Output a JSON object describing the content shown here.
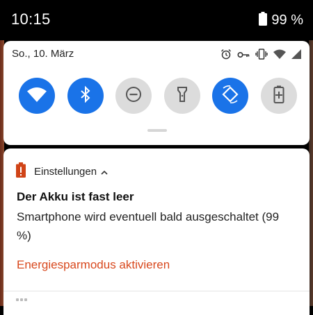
{
  "status_bar": {
    "time": "10:15",
    "battery_percent": "99 %"
  },
  "quick_settings": {
    "date": "So., 10. März",
    "status_icons": [
      "alarm-icon",
      "vpn-key-icon",
      "vibrate-icon",
      "wifi-signal-icon",
      "cell-signal-icon"
    ],
    "tiles": [
      {
        "name": "wifi",
        "icon": "wifi-icon",
        "state": "on"
      },
      {
        "name": "bluetooth",
        "icon": "bluetooth-icon",
        "state": "on"
      },
      {
        "name": "do-not-disturb",
        "icon": "do-not-disturb-icon",
        "state": "off"
      },
      {
        "name": "flashlight",
        "icon": "flashlight-icon",
        "state": "off"
      },
      {
        "name": "auto-rotate",
        "icon": "auto-rotate-icon",
        "state": "on"
      },
      {
        "name": "battery-saver",
        "icon": "battery-saver-icon",
        "state": "off"
      }
    ]
  },
  "notification": {
    "app_name": "Einstellungen",
    "app_icon": "battery-alert-icon",
    "title": "Der Akku ist fast leer",
    "text": "Smartphone wird eventuell bald ausgeschaltet (99 %)",
    "action": "Energiesparmodus aktivieren"
  },
  "colors": {
    "accent_blue": "#1a73e8",
    "tile_off": "#dcdcdc",
    "action_orange": "#d8481d",
    "alert_icon": "#d04417"
  }
}
